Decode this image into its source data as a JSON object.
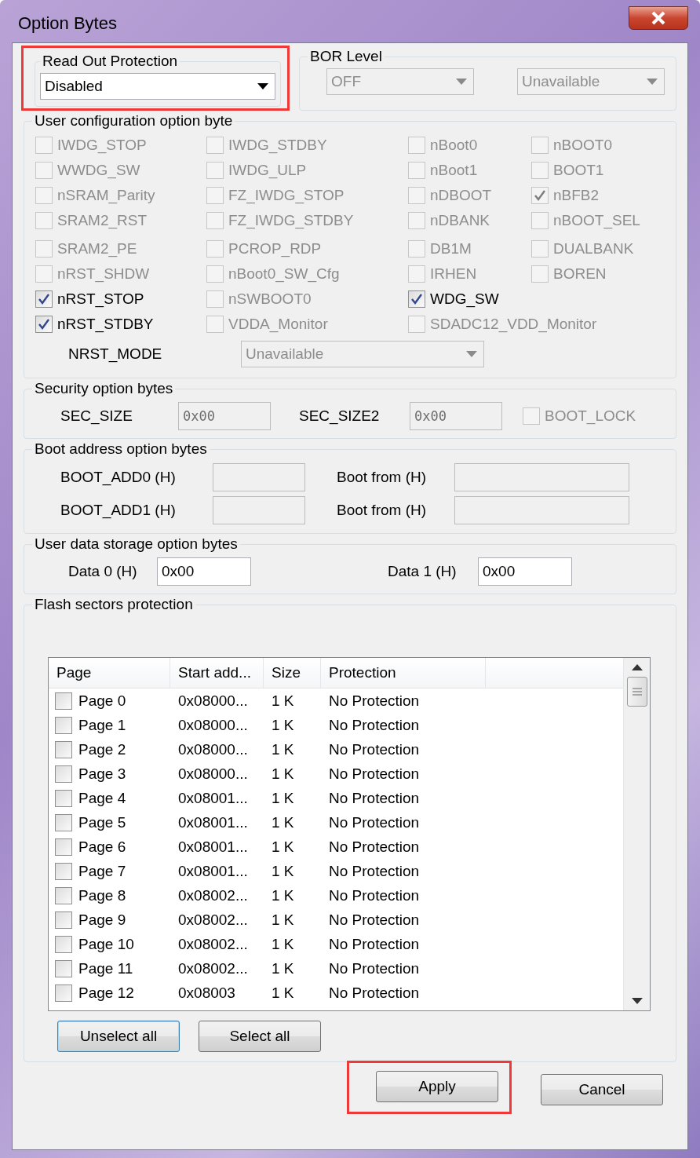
{
  "window": {
    "title": "Option Bytes"
  },
  "read_out_protection": {
    "title": "Read Out Protection",
    "value": "Disabled",
    "disabled": false,
    "highlighted": true
  },
  "bor_level": {
    "title": "BOR Level",
    "dropdowns": [
      {
        "value": "OFF",
        "disabled": true
      },
      {
        "value": "Unavailable",
        "disabled": true
      }
    ]
  },
  "user_configuration": {
    "title": "User configuration option byte",
    "rows": [
      [
        {
          "label": "IWDG_STOP",
          "checked": false,
          "disabled": true
        },
        {
          "label": "IWDG_STDBY",
          "checked": false,
          "disabled": true
        },
        {
          "label": "nBoot0",
          "checked": false,
          "disabled": true
        },
        {
          "label": "nBOOT0",
          "checked": false,
          "disabled": true
        }
      ],
      [
        {
          "label": "WWDG_SW",
          "checked": false,
          "disabled": true
        },
        {
          "label": "IWDG_ULP",
          "checked": false,
          "disabled": true
        },
        {
          "label": "nBoot1",
          "checked": false,
          "disabled": true
        },
        {
          "label": "BOOT1",
          "checked": false,
          "disabled": true
        }
      ],
      [
        {
          "label": "nSRAM_Parity",
          "checked": false,
          "disabled": true
        },
        {
          "label": "FZ_IWDG_STOP",
          "checked": false,
          "disabled": true
        },
        {
          "label": "nDBOOT",
          "checked": false,
          "disabled": true
        },
        {
          "label": "nBFB2",
          "checked": true,
          "disabled": true
        }
      ],
      [
        {
          "label": "SRAM2_RST",
          "checked": false,
          "disabled": true
        },
        {
          "label": "FZ_IWDG_STDBY",
          "checked": false,
          "disabled": true
        },
        {
          "label": "nDBANK",
          "checked": false,
          "disabled": true
        },
        {
          "label": "nBOOT_SEL",
          "checked": false,
          "disabled": true
        }
      ],
      [
        {
          "label": "SRAM2_PE",
          "checked": false,
          "disabled": true
        },
        {
          "label": "PCROP_RDP",
          "checked": false,
          "disabled": true
        },
        {
          "label": "DB1M",
          "checked": false,
          "disabled": true
        },
        {
          "label": "DUALBANK",
          "checked": false,
          "disabled": true
        }
      ],
      [
        {
          "label": "nRST_SHDW",
          "checked": false,
          "disabled": true
        },
        {
          "label": "nBoot0_SW_Cfg",
          "checked": false,
          "disabled": true
        },
        {
          "label": "IRHEN",
          "checked": false,
          "disabled": true
        },
        {
          "label": "BOREN",
          "checked": false,
          "disabled": true
        }
      ],
      [
        {
          "label": "nRST_STOP",
          "checked": true,
          "disabled": false
        },
        {
          "label": "nSWBOOT0",
          "checked": false,
          "disabled": true
        },
        {
          "label": "WDG_SW",
          "checked": true,
          "disabled": false
        }
      ],
      [
        {
          "label": "nRST_STDBY",
          "checked": true,
          "disabled": false
        },
        {
          "label": "VDDA_Monitor",
          "checked": false,
          "disabled": true
        },
        {
          "label": "SDADC12_VDD_Monitor",
          "checked": false,
          "disabled": true
        }
      ]
    ],
    "nrst_mode": {
      "label": "NRST_MODE",
      "value": "Unavailable",
      "disabled": true
    }
  },
  "security": {
    "title": "Security option bytes",
    "fields": [
      {
        "label": "SEC_SIZE",
        "value": "0x00",
        "disabled": true
      },
      {
        "label": "SEC_SIZE2",
        "value": "0x00",
        "disabled": true
      }
    ],
    "boot_lock": {
      "label": "BOOT_LOCK",
      "checked": false,
      "disabled": true
    }
  },
  "boot_address": {
    "title": "Boot address option bytes",
    "rows": [
      [
        {
          "label": "BOOT_ADD0 (H)",
          "disabled": true
        },
        {
          "label": "Boot from (H)",
          "disabled": true
        }
      ],
      [
        {
          "label": "BOOT_ADD1 (H)",
          "disabled": true
        },
        {
          "label": "Boot from (H)",
          "disabled": true
        }
      ]
    ]
  },
  "user_data": {
    "title": "User data storage option bytes",
    "fields": [
      {
        "label": "Data 0 (H)",
        "value": "0x00",
        "disabled": false
      },
      {
        "label": "Data 1 (H)",
        "value": "0x00",
        "disabled": false
      }
    ]
  },
  "flash_protection": {
    "title": "Flash sectors protection",
    "columns": [
      "Page",
      "Start add...",
      "Size",
      "Protection"
    ],
    "rows": [
      {
        "checked": false,
        "page": "Page 0",
        "start": "0x08000...",
        "size": "1 K",
        "protection": "No Protection"
      },
      {
        "checked": false,
        "page": "Page 1",
        "start": "0x08000...",
        "size": "1 K",
        "protection": "No Protection"
      },
      {
        "checked": false,
        "page": "Page 2",
        "start": "0x08000...",
        "size": "1 K",
        "protection": "No Protection"
      },
      {
        "checked": false,
        "page": "Page 3",
        "start": "0x08000...",
        "size": "1 K",
        "protection": "No Protection"
      },
      {
        "checked": false,
        "page": "Page 4",
        "start": "0x08001...",
        "size": "1 K",
        "protection": "No Protection"
      },
      {
        "checked": false,
        "page": "Page 5",
        "start": "0x08001...",
        "size": "1 K",
        "protection": "No Protection"
      },
      {
        "checked": false,
        "page": "Page 6",
        "start": "0x08001...",
        "size": "1 K",
        "protection": "No Protection"
      },
      {
        "checked": false,
        "page": "Page 7",
        "start": "0x08001...",
        "size": "1 K",
        "protection": "No Protection"
      },
      {
        "checked": false,
        "page": "Page 8",
        "start": "0x08002...",
        "size": "1 K",
        "protection": "No Protection"
      },
      {
        "checked": false,
        "page": "Page 9",
        "start": "0x08002...",
        "size": "1 K",
        "protection": "No Protection"
      },
      {
        "checked": false,
        "page": "Page 10",
        "start": "0x08002...",
        "size": "1 K",
        "protection": "No Protection"
      },
      {
        "checked": false,
        "page": "Page 11",
        "start": "0x08002...",
        "size": "1 K",
        "protection": "No Protection"
      },
      {
        "checked": false,
        "page": "Page 12",
        "start": "0x08003",
        "size": "1 K",
        "protection": "No Protection"
      }
    ],
    "buttons": [
      {
        "label": "Unselect all",
        "focused": true
      },
      {
        "label": "Select all",
        "focused": false
      }
    ]
  },
  "footer_buttons": [
    {
      "label": "Apply",
      "highlighted": true
    },
    {
      "label": "Cancel",
      "highlighted": false
    }
  ]
}
